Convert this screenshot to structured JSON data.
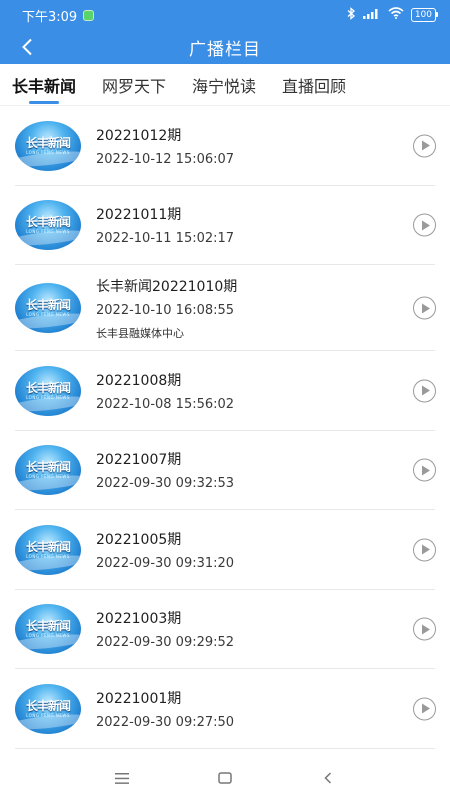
{
  "status": {
    "time": "下午3:09",
    "battery": "100"
  },
  "header": {
    "title": "广播栏目"
  },
  "tabs": [
    {
      "label": "长丰新闻"
    },
    {
      "label": "网罗天下"
    },
    {
      "label": "海宁悦读"
    },
    {
      "label": "直播回顾"
    }
  ],
  "thumb": {
    "text": "长丰新闻",
    "sub": "LONG FENG NEWS"
  },
  "items": [
    {
      "title": "20221012期",
      "date": "2022-10-12 15:06:07"
    },
    {
      "title": "20221011期",
      "date": "2022-10-11 15:02:17"
    },
    {
      "title": "长丰新闻20221010期",
      "date": "2022-10-10 16:08:55",
      "source": "长丰县融媒体中心"
    },
    {
      "title": "20221008期",
      "date": "2022-10-08 15:56:02"
    },
    {
      "title": "20221007期",
      "date": "2022-09-30 09:32:53"
    },
    {
      "title": "20221005期",
      "date": "2022-09-30 09:31:20"
    },
    {
      "title": "20221003期",
      "date": "2022-09-30 09:29:52"
    },
    {
      "title": "20221001期",
      "date": "2022-09-30 09:27:50"
    }
  ],
  "colors": {
    "primary": "#3a8ee6"
  },
  "icons": {
    "back": "chevron-left-icon",
    "play": "play-circle-icon",
    "menu": "menu-icon",
    "home": "home-icon",
    "nav_back": "nav-back-icon"
  }
}
